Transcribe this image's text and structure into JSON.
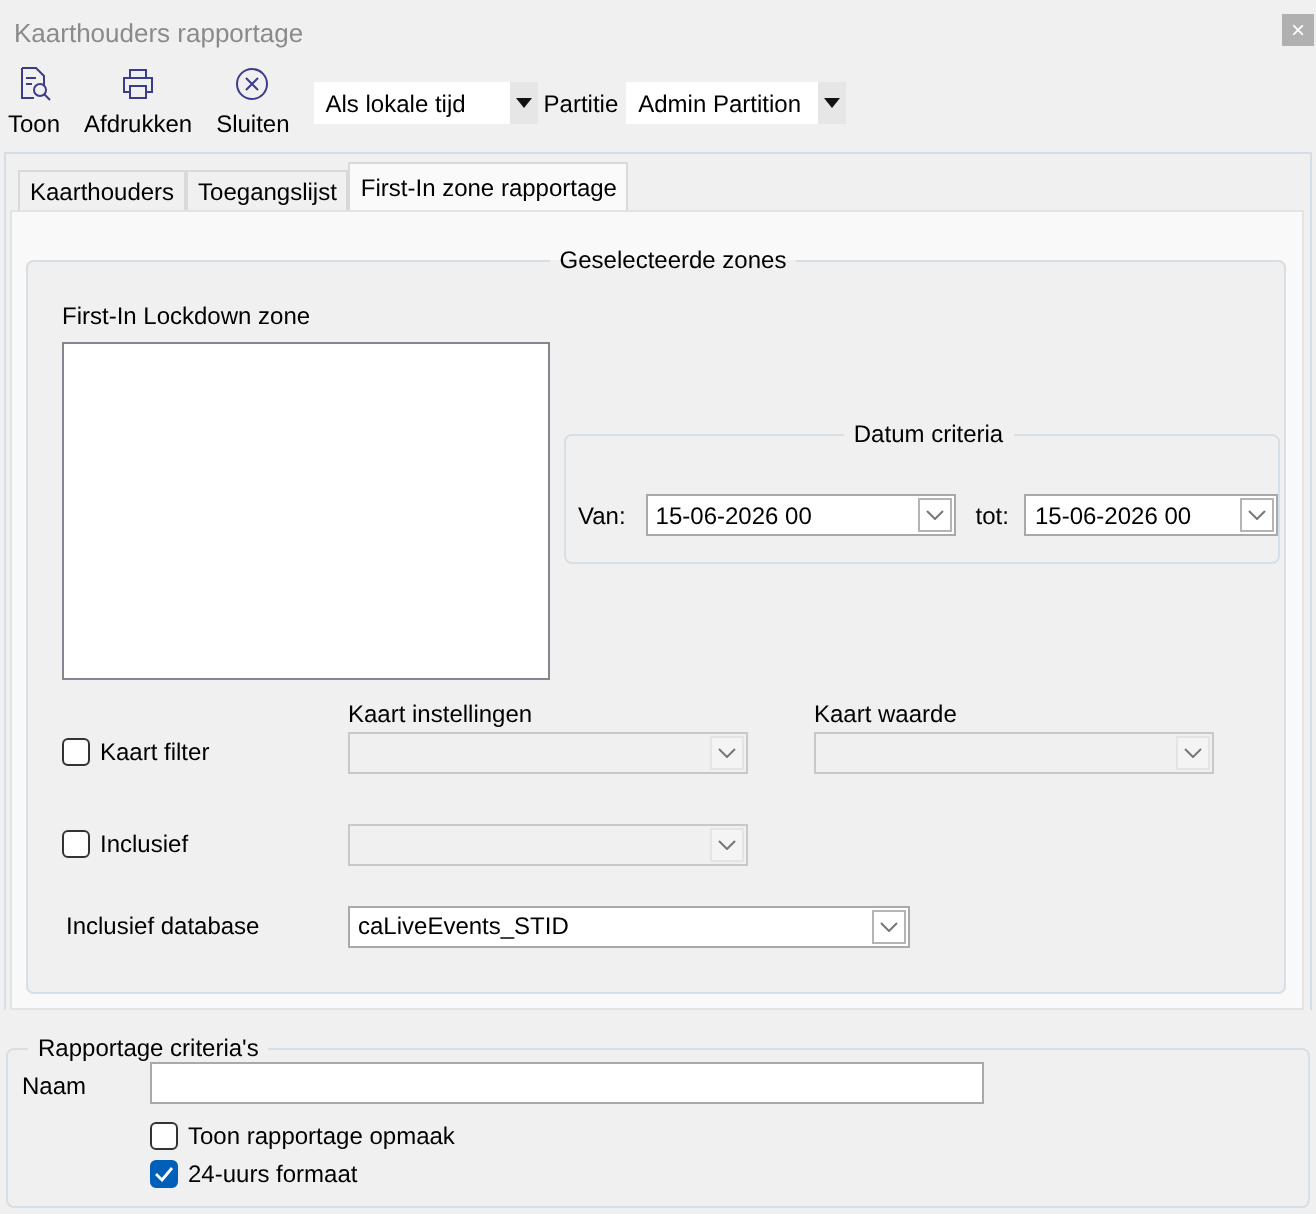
{
  "window": {
    "title": "Kaarthouders rapportage",
    "close": "×"
  },
  "toolbar": {
    "buttons": [
      {
        "label": "Toon",
        "kind": "view"
      },
      {
        "label": "Afdrukken",
        "kind": "print"
      },
      {
        "label": "Sluiten",
        "kind": "close"
      }
    ],
    "time_mode": {
      "value": "Als lokale tijd"
    },
    "partition": {
      "label": "Partitie",
      "value": "Admin Partition"
    }
  },
  "tabs": [
    {
      "label": "Kaarthouders",
      "selected": false
    },
    {
      "label": "Toegangslijst",
      "selected": false
    },
    {
      "label": "First-In zone rapportage",
      "selected": true
    }
  ],
  "zones_group": {
    "title": "Geselecteerde zones",
    "list_label": "First-In Lockdown zone",
    "date_group": {
      "title": "Datum criteria",
      "from_label": "Van:",
      "from_value": "15-06-2026 00",
      "to_label": "tot:",
      "to_value": "15-06-2026 00"
    },
    "settings_label": "Kaart instellingen",
    "value_label": "Kaart waarde",
    "card_filter": {
      "label": "Kaart filter",
      "checked": false,
      "settings_combo": {
        "disabled": true
      },
      "value_combo": {
        "disabled": true
      }
    },
    "inclusive": {
      "label": "Inclusief",
      "checked": false,
      "combo": {
        "disabled": true
      }
    },
    "database": {
      "label": "Inclusief database",
      "value": "caLiveEvents_STID"
    }
  },
  "report_group": {
    "title": "Rapportage criteria's",
    "name_label": "Naam",
    "options": [
      {
        "label": "Toon rapportage opmaak",
        "checked": false
      },
      {
        "label": "24-uurs formaat",
        "checked": true
      }
    ]
  }
}
